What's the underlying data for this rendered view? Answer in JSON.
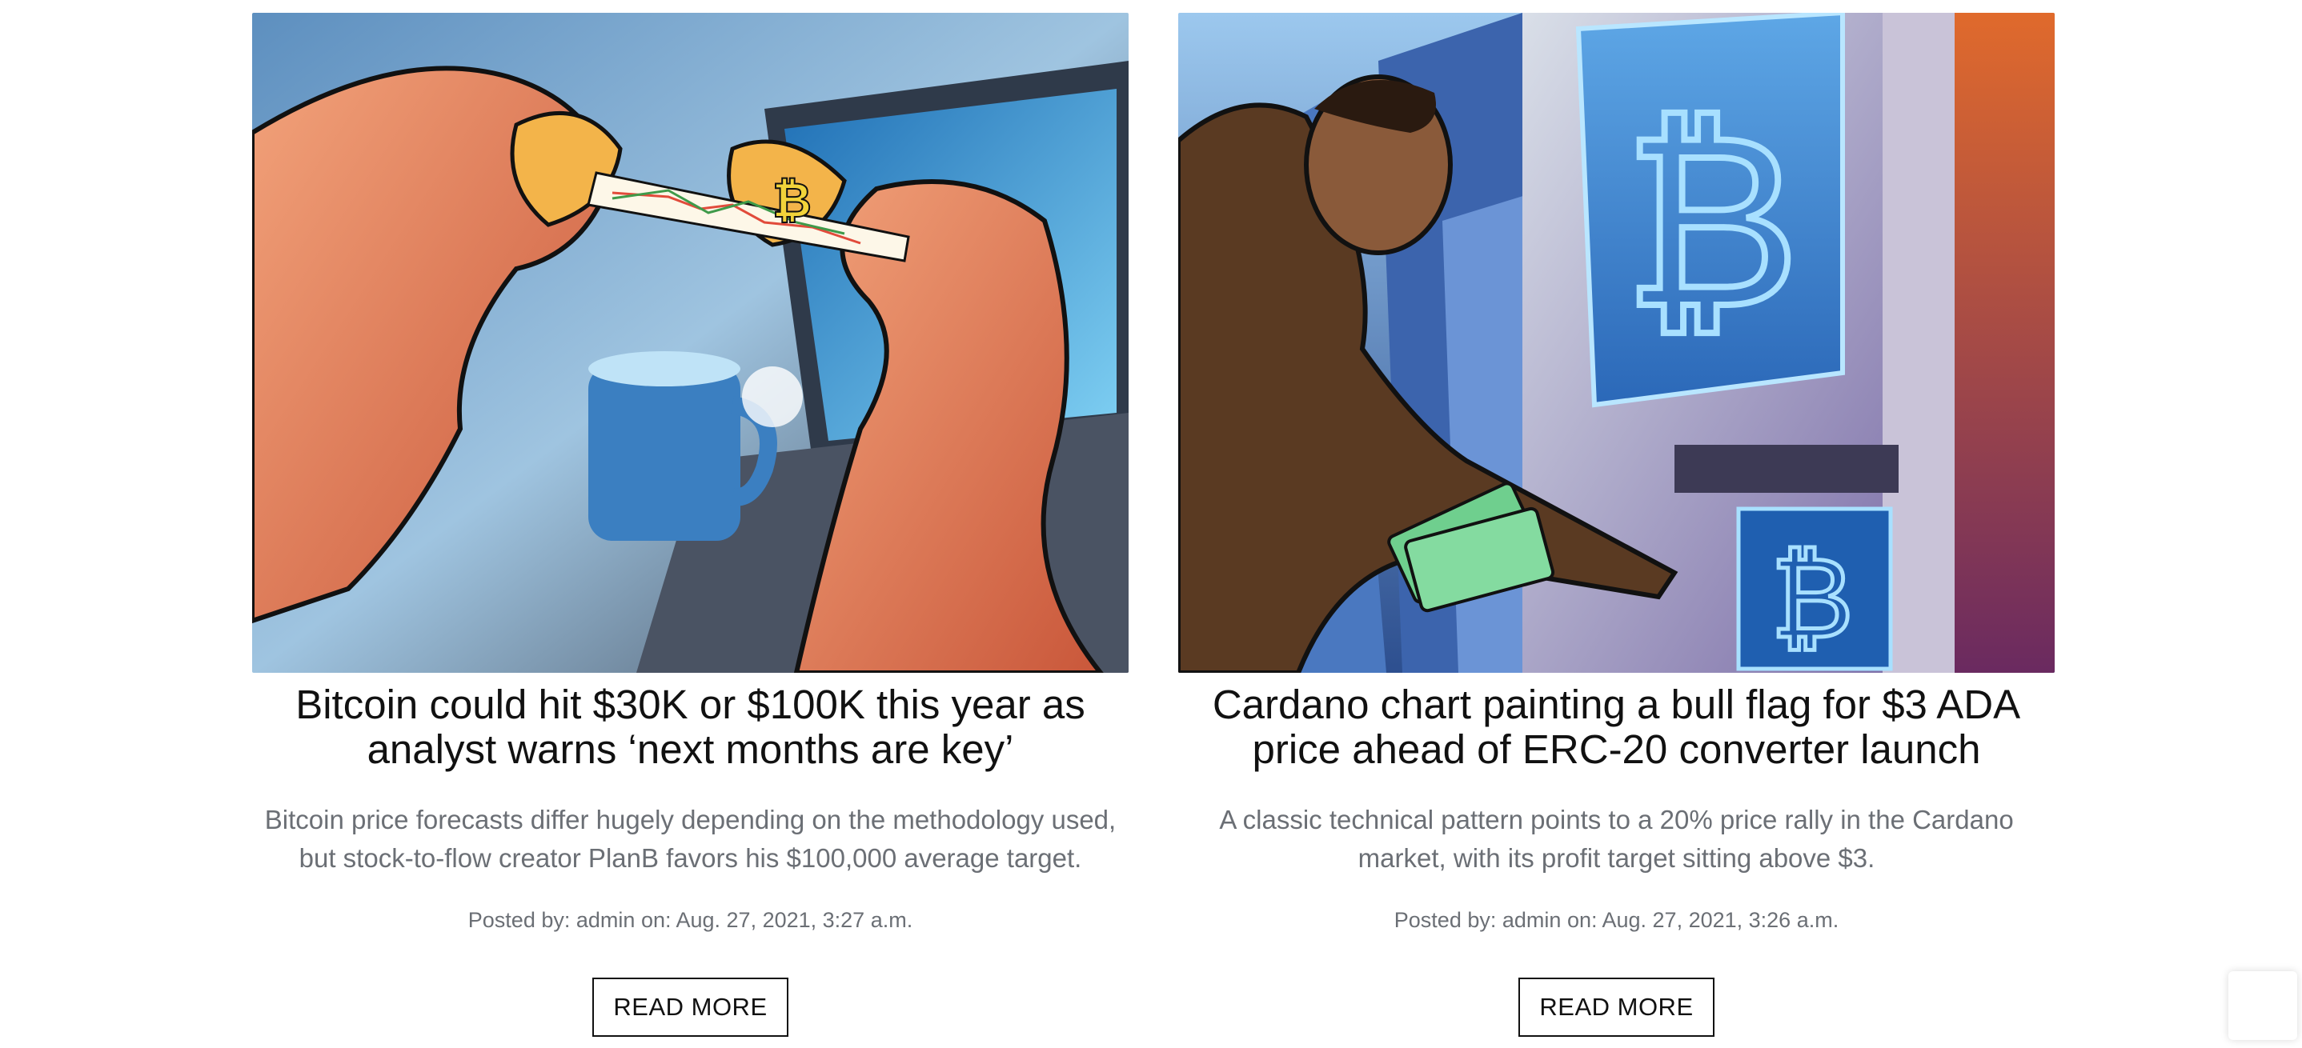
{
  "posts": [
    {
      "image_alt": "Hands breaking a fortune cookie with a bitcoin chart slip in front of a laptop",
      "title": "Bitcoin could hit $30K or $100K this year as analyst warns ‘next months are key’",
      "excerpt": "Bitcoin price forecasts differ hugely depending on the methodology used, but stock-to-flow creator PlanB favors his $100,000 average target.",
      "meta_prefix": "Posted by:",
      "author": "admin",
      "date_prefix": "on:",
      "date": "Aug. 27, 2021, 3:27 a.m.",
      "button_label": "READ MORE"
    },
    {
      "image_alt": "Man inserting cash into a bitcoin ATM",
      "title": "Cardano chart painting a bull flag for $3 ADA price ahead of ERC-20 converter launch",
      "excerpt": "A classic technical pattern points to a 20% price rally in the Cardano market, with its profit target sitting above $3.",
      "meta_prefix": "Posted by:",
      "author": "admin",
      "date_prefix": "on:",
      "date": "Aug. 27, 2021, 3:26 a.m.",
      "button_label": "READ MORE"
    }
  ],
  "colors": {
    "title": "#111111",
    "muted": "#6b6f75",
    "button_border": "#111111"
  }
}
